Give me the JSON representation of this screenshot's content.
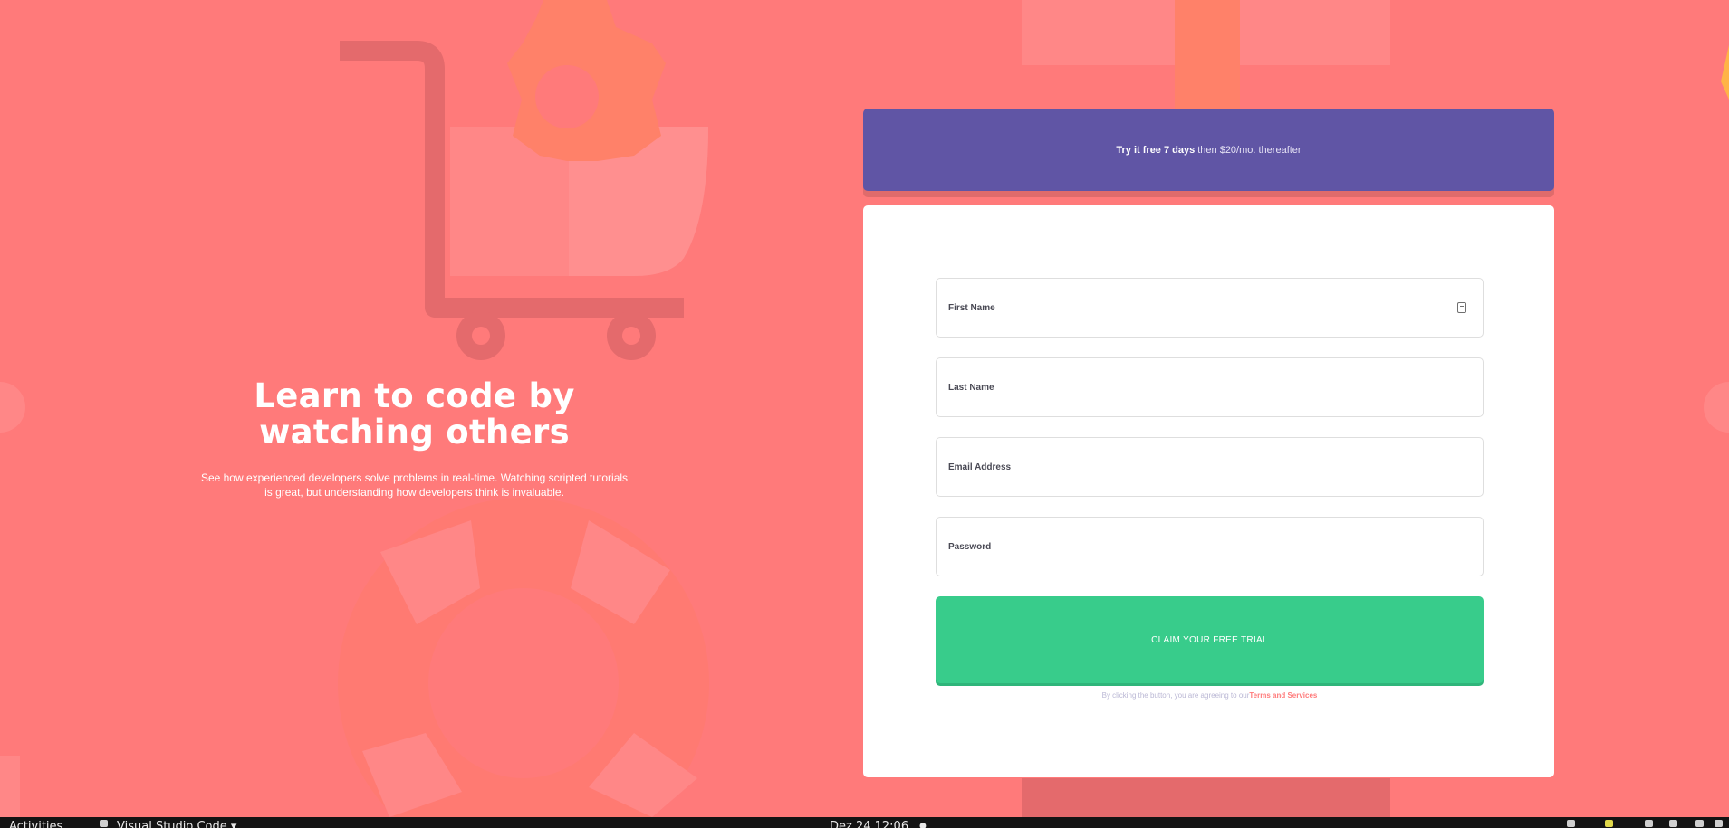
{
  "hero": {
    "title": "Learn to code by watching others",
    "description": "See how experienced developers solve problems in real-time. Watching scripted tutorials is great, but understanding how developers think is invaluable."
  },
  "banner": {
    "offer_bold": "Try it free 7 days",
    "offer_rest": "then $20/mo. thereafter"
  },
  "form": {
    "first_name_placeholder": "First Name",
    "last_name_placeholder": "Last Name",
    "email_placeholder": "Email Address",
    "password_placeholder": "Password",
    "submit_label": "CLAIM YOUR FREE TRIAL",
    "terms_text": "By clicking the button, you are agreeing to our",
    "terms_link": "Terms and Services"
  },
  "taskbar": {
    "activities": "Activities",
    "app_name": "Visual Studio Code",
    "app_menu_arrow": "▾",
    "clock": "Dez 24  12:06",
    "notification_dot": "●"
  },
  "colors": {
    "background": "#ff7a7a",
    "banner": "#6055a5",
    "button": "#38cc8b",
    "terms_link": "#ff7a7a",
    "taskbar": "#141414"
  },
  "icons": [
    "cart-illustration",
    "gear-illustration",
    "lifebuoy-illustration",
    "autofill-contact-icon",
    "app-icon",
    "tray-icons"
  ]
}
